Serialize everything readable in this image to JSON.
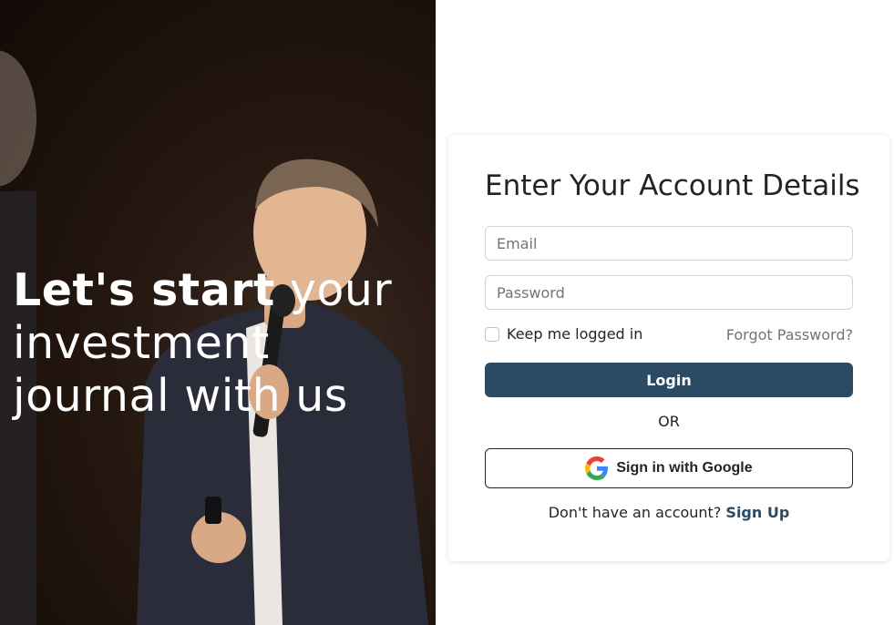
{
  "hero": {
    "title_bold": "Let's start",
    "title_rest": " your investment journal with us"
  },
  "login": {
    "heading": "Enter Your Account Details",
    "email_placeholder": "Email",
    "password_placeholder": "Password",
    "remember_label": "Keep me logged in",
    "remember_checked": false,
    "forgot_label": "Forgot Password?",
    "login_label": "Login",
    "divider": "OR",
    "google_label": "Sign in with Google",
    "google_icon": "google-g-icon",
    "signup_prompt": "Don't have an account?",
    "signup_label": "Sign Up"
  },
  "colors": {
    "primary": "#2b4a64",
    "muted": "#6c757d",
    "hero_overlay": "#1a100a"
  }
}
